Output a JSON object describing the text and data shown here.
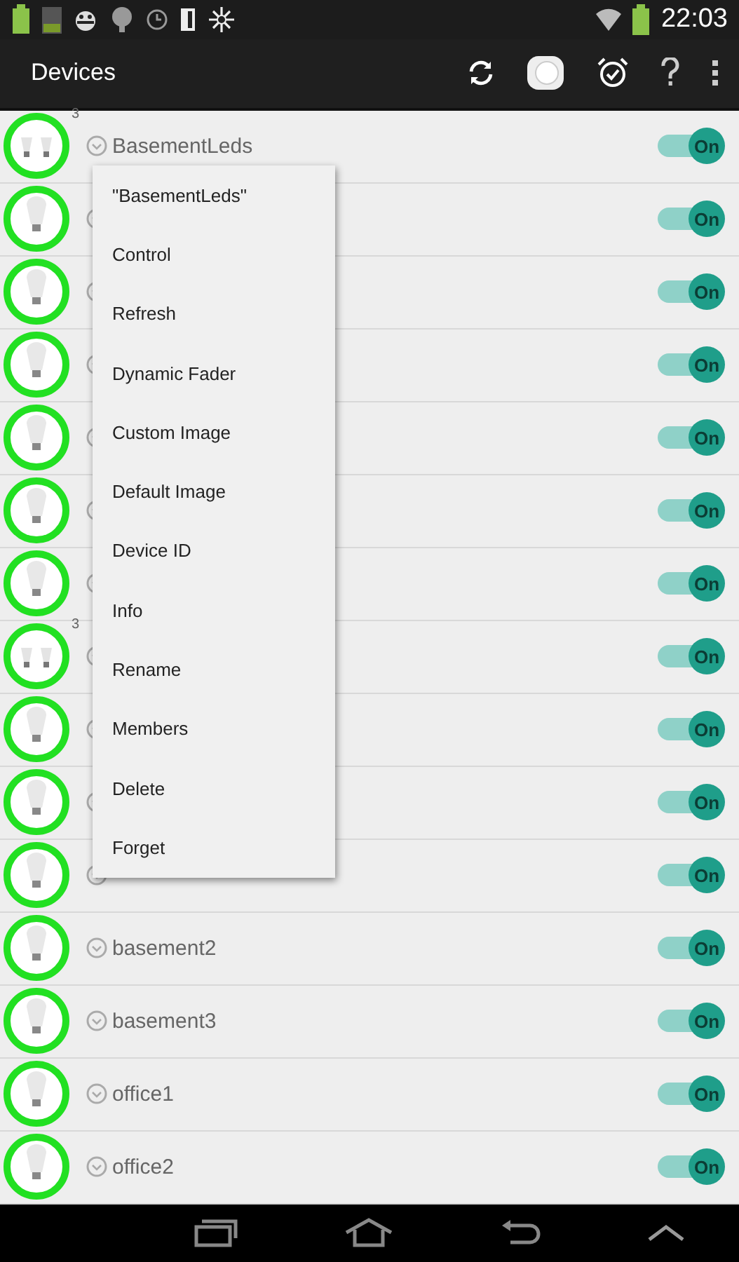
{
  "status_bar": {
    "time": "22:03"
  },
  "action_bar": {
    "title": "Devices"
  },
  "devices": [
    {
      "kind": "group",
      "count": "3",
      "name": "BasementLeds",
      "switch": {
        "on": true,
        "label": "On"
      }
    },
    {
      "kind": "bulb",
      "switch": {
        "on": true,
        "label": "On"
      }
    },
    {
      "kind": "bulb",
      "switch": {
        "on": true,
        "label": "On"
      }
    },
    {
      "kind": "bulb",
      "switch": {
        "on": true,
        "label": "On"
      }
    },
    {
      "kind": "bulb",
      "switch": {
        "on": true,
        "label": "On"
      }
    },
    {
      "kind": "bulb",
      "switch": {
        "on": true,
        "label": "On"
      }
    },
    {
      "kind": "bulb",
      "switch": {
        "on": true,
        "label": "On"
      }
    },
    {
      "kind": "group",
      "count": "3",
      "switch": {
        "on": true,
        "label": "On"
      }
    },
    {
      "kind": "bulb",
      "switch": {
        "on": true,
        "label": "On"
      }
    },
    {
      "kind": "bulb",
      "switch": {
        "on": true,
        "label": "On"
      }
    },
    {
      "kind": "bulb",
      "switch": {
        "on": true,
        "label": "On"
      }
    },
    {
      "kind": "bulb",
      "name": "basement2",
      "switch": {
        "on": true,
        "label": "On"
      }
    },
    {
      "kind": "bulb",
      "name": "basement3",
      "switch": {
        "on": true,
        "label": "On"
      }
    },
    {
      "kind": "bulb",
      "name": "office1",
      "switch": {
        "on": true,
        "label": "On"
      }
    },
    {
      "kind": "bulb",
      "name": "office2",
      "switch": {
        "on": true,
        "label": "On"
      }
    }
  ],
  "context_menu": {
    "items": [
      "\"BasementLeds\"",
      "Control",
      "Refresh",
      "Dynamic Fader",
      "Custom Image",
      "Default Image",
      "Device ID",
      "Info",
      "Rename",
      "Members",
      "Delete",
      "Forget"
    ]
  }
}
